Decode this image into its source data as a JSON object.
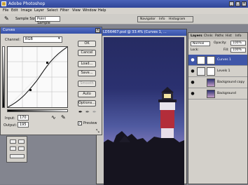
{
  "app": {
    "title": "Adobe Photoshop",
    "icon": "photoshop-app-icon"
  },
  "menu": [
    "File",
    "Edit",
    "Image",
    "Layer",
    "Select",
    "Filter",
    "View",
    "Window",
    "Help"
  ],
  "options_bar": {
    "tool_icon": "eyedropper-icon",
    "sample_label": "Sample Size:",
    "sample_value": "Point Sample"
  },
  "navigator_tabs": [
    "Navigator",
    "Info",
    "Histogram"
  ],
  "curves_dialog": {
    "title": "Curves",
    "channel_label": "Channel:",
    "channel_value": "RGB",
    "input_label": "Input:",
    "input_value": "170",
    "output_label": "Output:",
    "output_value": "195",
    "preview_label": "Preview",
    "preview_checked": true,
    "buttons": [
      "OK",
      "Cancel",
      "Load...",
      "Save...",
      "Smooth",
      "Auto",
      "Options..."
    ],
    "disabled_buttons": [
      "Smooth"
    ]
  },
  "image_window": {
    "title": "LD56467.psd @ 33.4% (Curves 1, ..."
  },
  "layers_panel": {
    "tabs": [
      "Layers",
      "Chnls",
      "Paths",
      "Hist",
      "Info"
    ],
    "normal_label": "Normal",
    "opacity_label": "Opacity:",
    "opacity_value": "100%",
    "lock_label": "Lock:",
    "fill_label": "Fill:",
    "fill_value": "100%",
    "layers": [
      {
        "name": "Curves 1",
        "selected": true
      },
      {
        "name": "Levels 1",
        "selected": false
      },
      {
        "name": "Background copy",
        "selected": false
      },
      {
        "name": "Background",
        "selected": false
      }
    ]
  },
  "colors": {
    "title_bar": "#3550a8",
    "selection": "#3f56a8",
    "sky_top": "#262b62",
    "sky_bottom": "#c59ec7",
    "lighthouse_red": "#b32d3a"
  }
}
